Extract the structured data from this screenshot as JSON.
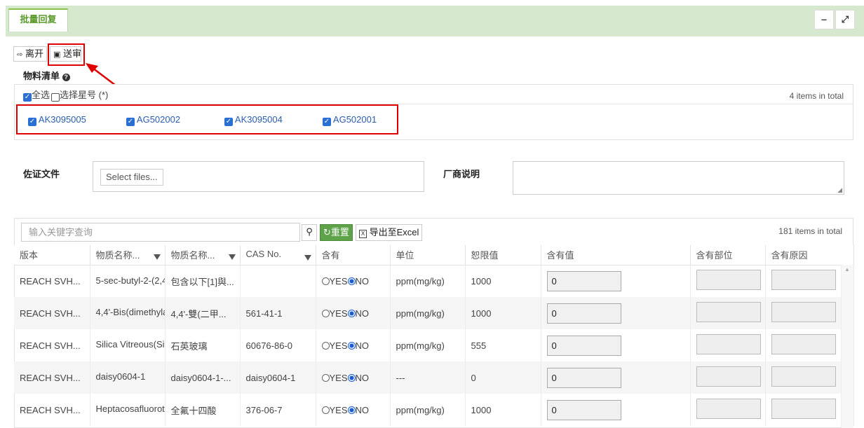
{
  "tab": {
    "label": "批量回复"
  },
  "window_controls": {
    "minimize": "‒",
    "expand": "⤢"
  },
  "toolbar": {
    "leave_label": "离开",
    "submit_label": "送审"
  },
  "materials": {
    "title": "物料清单",
    "select_all_label": "全选",
    "select_star_label": "选择星号 (*)",
    "total_text": "4 items in total",
    "items": [
      {
        "label": "AK3095005",
        "checked": true
      },
      {
        "label": "AG502002",
        "checked": true
      },
      {
        "label": "AK3095004",
        "checked": true
      },
      {
        "label": "AG502001",
        "checked": true
      }
    ]
  },
  "evidence": {
    "label": "佐证文件",
    "select_files_label": "Select files..."
  },
  "vendor_note": {
    "label": "厂商说明",
    "value": ""
  },
  "search": {
    "placeholder": "输入关键字查询",
    "reset_label": "重置",
    "export_label": "导出至Excel",
    "total_text": "181 items in total"
  },
  "table": {
    "columns": [
      "版本",
      "物质名称...",
      "物质名称...",
      "CAS No.",
      "含有",
      "单位",
      "恕限值",
      "含有值",
      "含有部位",
      "含有原因"
    ],
    "yes_label": "YES",
    "no_label": "NO",
    "rows": [
      {
        "version": "REACH SVH...",
        "name_en": "5-sec-butyl-2-(2,4",
        "name_cn": "包含以下[1]與...",
        "cas": "",
        "contains": "NO",
        "unit": "ppm(mg/kg)",
        "limit": "1000",
        "value": "0"
      },
      {
        "version": "REACH SVH...",
        "name_en": "4,4'-Bis(dimethyla",
        "name_cn": "4,4'-雙(二甲...",
        "cas": "561-41-1",
        "contains": "NO",
        "unit": "ppm(mg/kg)",
        "limit": "1000",
        "value": "0"
      },
      {
        "version": "REACH SVH...",
        "name_en": "Silica Vitreous(Si(",
        "name_cn": "石英玻璃",
        "cas": "60676-86-0",
        "contains": "NO",
        "unit": "ppm(mg/kg)",
        "limit": "555",
        "value": "0"
      },
      {
        "version": "REACH SVH...",
        "name_en": "daisy0604-1",
        "name_cn": "daisy0604-1-...",
        "cas": "daisy0604-1",
        "contains": "NO",
        "unit": "---",
        "limit": "0",
        "value": "0"
      },
      {
        "version": "REACH SVH...",
        "name_en": "Heptacosafluorote",
        "name_cn": "全氟十四酸",
        "cas": "376-06-7",
        "contains": "NO",
        "unit": "ppm(mg/kg)",
        "limit": "1000",
        "value": "0"
      }
    ]
  }
}
